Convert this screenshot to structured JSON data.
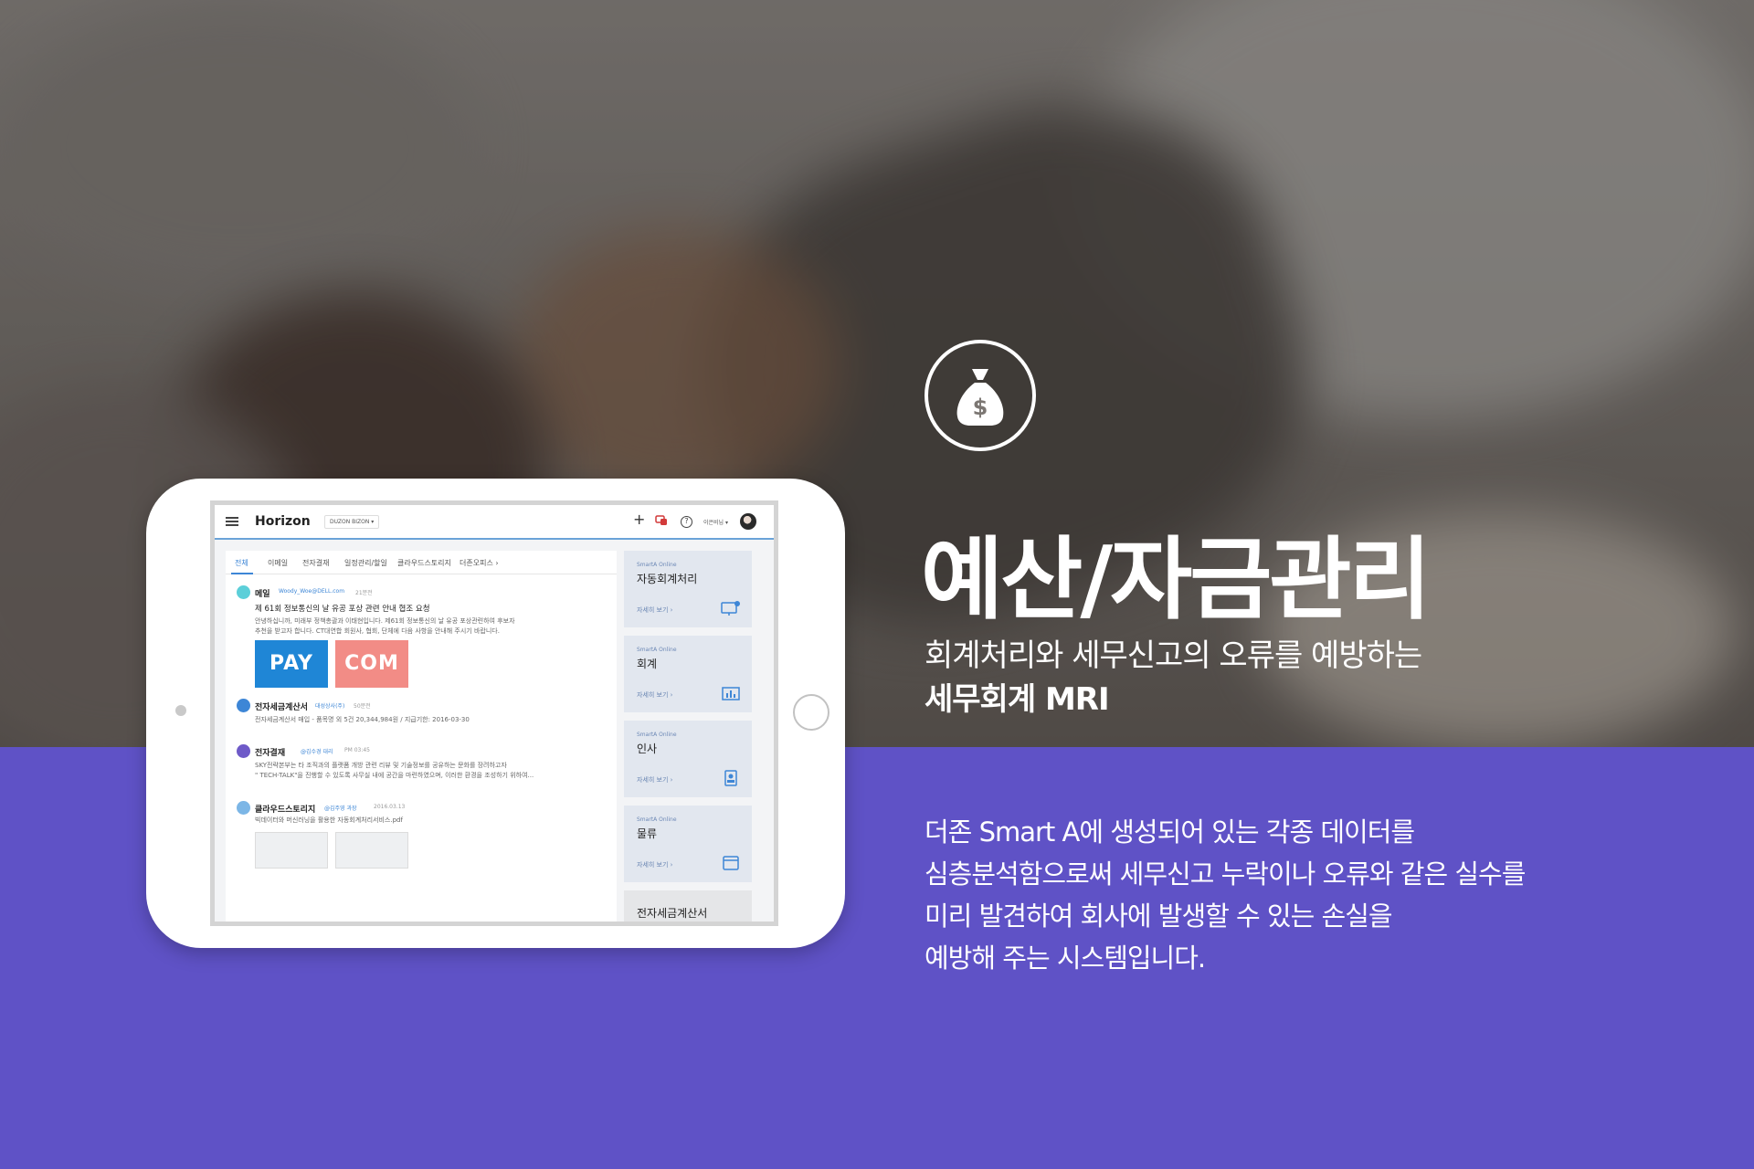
{
  "colors": {
    "brand_purple": "#5f52c6",
    "accent_blue": "#3d86d6",
    "white": "#ffffff"
  },
  "hero": {
    "icon": "money-bag-icon",
    "title": "예산/자금관리",
    "subtitle_line1": "회계처리와 세무신고의 오류를 예방하는",
    "subtitle_line2": "세무회계 MRI"
  },
  "description": [
    "더존 Smart A에 생성되어 있는 각종 데이터를",
    "심층분석함으로써 세무신고 누락이나 오류와 같은 실수를",
    "미리 발견하여 회사에 발생할 수 있는 손실을",
    "예방해 주는 시스템입니다."
  ],
  "app": {
    "brand": "Horizon",
    "company_selector": "DUZON BIZON ▾",
    "user_label": "이은비님 ▾",
    "tabs": [
      "전체",
      "이메일",
      "전자결재",
      "일정관리/할일",
      "클라우드스토리지",
      "더존오피스 ›"
    ],
    "feed": {
      "mail": {
        "title": "메일",
        "from": "Woody_Woe@DELL.com",
        "time": "21분전",
        "subject": "제 61회 정보통신의 날 유공 포상 관련 안내 협조 요청",
        "body1": "안녕하십니까, 미래부 정책총괄과 이태현입니다.  제61회 정보통신의 날 유공 포상관련하여 후보자",
        "body2": "추천을 받고자 합니다.  CT대연합 회원사, 협회, 단체에 다음 사항을 안내해 주시기 바랍니다.",
        "thumb_pay": "PAY",
        "thumb_com": "COM"
      },
      "tax": {
        "title": "전자세금계산서",
        "from": "대성상사(주)",
        "time": "50분전",
        "body": "전자세금계산서 매입 - 품목명 외 5건 20,344,984원 / 지급기한: 2016-03-30"
      },
      "approval": {
        "title": "전자결재",
        "from": "@김수경 대리",
        "time": "PM 03:45",
        "body1": "SKY전략본부는 타 조직과의 플랫폼 개방 관련 리뷰 및 기술정보를 공유하는 문화를 장려하고자",
        "body2": "\" TECH-TALK\"을 진행할 수 있도록 사무실 내에 공간을 마련하였으며, 이러한 환경을 조성하기 위하여..."
      },
      "cloud": {
        "title": "클라우드스토리지",
        "from": "@김주영 과장",
        "time": "2016.03.13",
        "body": "빅데이터와 머신러닝을 활용한 자동회계처리서비스.pdf"
      }
    },
    "cards": [
      {
        "kicker": "SmartA Online",
        "title": "자동회계처리",
        "link": "자세히 보기 ›",
        "icon": "monitor-gear-icon"
      },
      {
        "kicker": "SmartA Online",
        "title": "회계",
        "link": "자세히 보기 ›",
        "icon": "bar-chart-icon"
      },
      {
        "kicker": "SmartA Online",
        "title": "인사",
        "link": "자세히 보기 ›",
        "icon": "id-badge-icon"
      },
      {
        "kicker": "SmartA Online",
        "title": "물류",
        "link": "자세히 보기 ›",
        "icon": "box-icon"
      }
    ],
    "tax_card_title": "전자세금계산서"
  }
}
